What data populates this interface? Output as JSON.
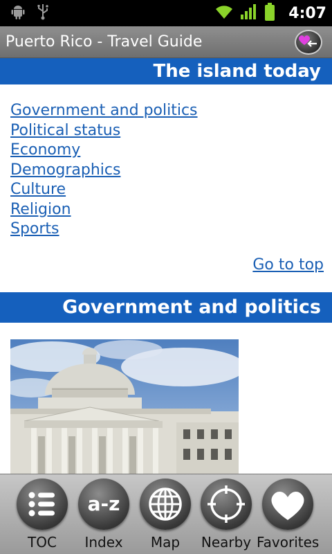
{
  "status_bar": {
    "time": "4:07",
    "icons": [
      "android-debug-icon",
      "usb-icon",
      "wifi-icon",
      "signal-icon",
      "battery-icon"
    ],
    "colors": {
      "wifi": "#8bd42a",
      "battery": "#8bd42a"
    }
  },
  "title_bar": {
    "title": "Puerto Rico - Travel Guide",
    "action_icon": "heart-back-icon"
  },
  "sections": {
    "island_today": {
      "header": "The island today"
    },
    "government": {
      "header": "Government and politics"
    }
  },
  "toc_links": [
    "Government and politics",
    "Political status",
    "Economy",
    "Demographics",
    "Culture",
    "Religion",
    "Sports"
  ],
  "go_to_top": "Go to top",
  "photo": {
    "subject": "capitol-building"
  },
  "toolbar": {
    "items": [
      {
        "label": "TOC",
        "icon": "list-icon"
      },
      {
        "label": "Index",
        "icon": "a-z-icon",
        "icon_text": "a-z"
      },
      {
        "label": "Map",
        "icon": "globe-icon"
      },
      {
        "label": "Nearby",
        "icon": "crosshair-icon"
      },
      {
        "label": "Favorites",
        "icon": "heart-icon"
      }
    ]
  },
  "colors": {
    "section_header": "#1560bd",
    "link": "#1a5fb4",
    "title_bar": "#7f7f7f"
  }
}
